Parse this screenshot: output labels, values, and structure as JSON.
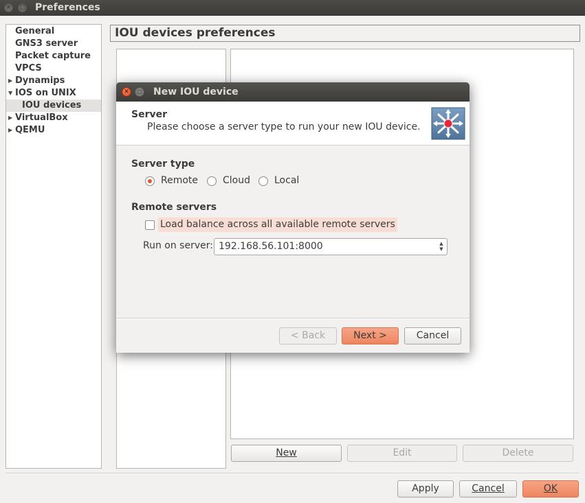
{
  "window": {
    "title": "Preferences"
  },
  "tree": {
    "items": [
      {
        "label": "General",
        "expander": ""
      },
      {
        "label": "GNS3 server",
        "expander": ""
      },
      {
        "label": "Packet capture",
        "expander": ""
      },
      {
        "label": "VPCS",
        "expander": ""
      },
      {
        "label": "Dynamips",
        "expander": "▶"
      },
      {
        "label": "IOS on UNIX",
        "expander": "▼"
      },
      {
        "label": "IOU devices",
        "expander": ""
      },
      {
        "label": "VirtualBox",
        "expander": "▶"
      },
      {
        "label": "QEMU",
        "expander": "▶"
      }
    ],
    "selected": "IOU devices"
  },
  "page": {
    "title": "IOU devices preferences",
    "new_label": "New",
    "edit_label": "Edit",
    "delete_label": "Delete"
  },
  "footer": {
    "apply_label": "Apply",
    "cancel_label": "Cancel",
    "ok_label": "OK"
  },
  "dialog": {
    "title": "New IOU device",
    "header_title": "Server",
    "header_subtitle": "Please choose a server type to run your new IOU device.",
    "icon": "multilayer-switch-icon",
    "server_type_label": "Server type",
    "server_type_options": [
      "Remote",
      "Cloud",
      "Local"
    ],
    "server_type_selected": "Remote",
    "remote_servers_label": "Remote servers",
    "load_balance_label": "Load balance across all available remote servers",
    "load_balance_checked": false,
    "run_on_server_label": "Run on server:",
    "run_on_server_value": "192.168.56.101:8000",
    "back_label": "< Back",
    "next_label": "Next >",
    "cancel_label": "Cancel"
  },
  "colors": {
    "accent": "#ee8660",
    "radio_selected": "#e4572e",
    "titlebar": "#3c3b37",
    "highlight": "#f7ddd3"
  }
}
